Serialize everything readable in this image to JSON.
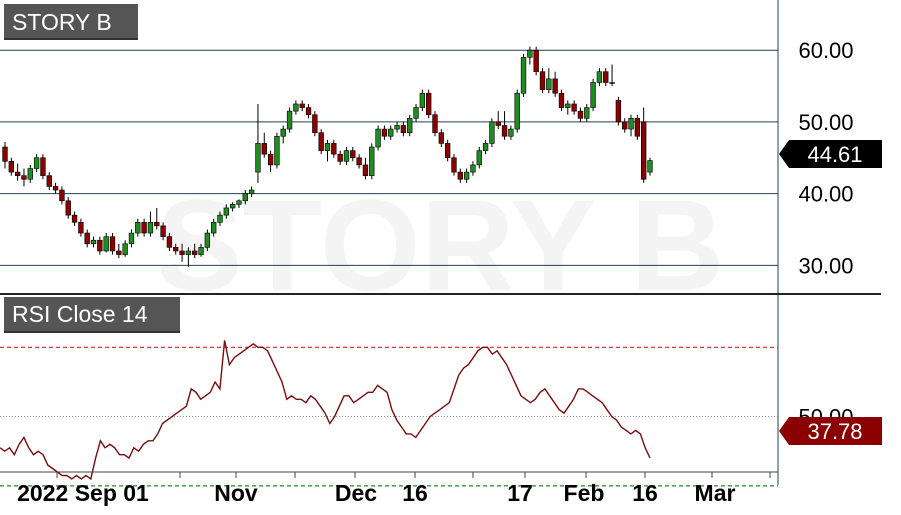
{
  "chart_data": [
    {
      "type": "candlestick",
      "title": "STORY B",
      "watermark": "STORY B",
      "ylim": [
        26,
        67
      ],
      "y_ticks": [
        "30.00",
        "40.00",
        "50.00",
        "60.00"
      ],
      "last_price": "44.61",
      "colors": {
        "up": "#1e8c1e",
        "down": "#8b0000",
        "last_badge": "#000000"
      },
      "candles": [
        [
          46.5,
          47.2,
          43.5,
          44.5
        ],
        [
          44.5,
          45.0,
          42.5,
          43.0
        ],
        [
          43.0,
          44.2,
          41.8,
          42.5
        ],
        [
          42.5,
          43.5,
          41.0,
          42.0
        ],
        [
          42.0,
          44.0,
          41.5,
          43.5
        ],
        [
          43.5,
          45.5,
          43.0,
          45.0
        ],
        [
          45.0,
          45.5,
          42.0,
          42.5
        ],
        [
          42.5,
          43.0,
          40.5,
          41.0
        ],
        [
          41.0,
          41.5,
          40.0,
          40.5
        ],
        [
          40.5,
          41.0,
          38.5,
          39.0
        ],
        [
          39.0,
          39.5,
          36.5,
          37.0
        ],
        [
          37.0,
          37.5,
          35.5,
          36.0
        ],
        [
          36.0,
          36.5,
          34.0,
          34.5
        ],
        [
          34.5,
          35.0,
          32.5,
          33.0
        ],
        [
          33.0,
          34.0,
          32.5,
          33.5
        ],
        [
          33.5,
          34.0,
          31.5,
          32.0
        ],
        [
          32.0,
          34.5,
          31.8,
          34.0
        ],
        [
          34.0,
          34.5,
          31.5,
          32.0
        ],
        [
          32.0,
          33.0,
          31.0,
          31.5
        ],
        [
          31.5,
          33.5,
          31.2,
          33.0
        ],
        [
          33.0,
          35.0,
          32.5,
          34.5
        ],
        [
          34.5,
          36.5,
          34.0,
          36.0
        ],
        [
          36.0,
          36.5,
          34.0,
          34.5
        ],
        [
          34.5,
          37.5,
          34.0,
          36.0
        ],
        [
          36.0,
          38.0,
          35.0,
          35.5
        ],
        [
          35.5,
          36.0,
          33.5,
          34.0
        ],
        [
          34.0,
          34.5,
          32.0,
          32.5
        ],
        [
          32.5,
          33.0,
          31.5,
          32.0
        ],
        [
          32.0,
          33.0,
          30.5,
          31.5
        ],
        [
          31.5,
          32.5,
          29.8,
          32.0
        ],
        [
          32.0,
          33.0,
          31.0,
          31.5
        ],
        [
          31.5,
          33.0,
          31.2,
          32.5
        ],
        [
          32.5,
          35.0,
          32.0,
          34.5
        ],
        [
          34.5,
          36.5,
          34.0,
          36.0
        ],
        [
          36.0,
          37.5,
          35.5,
          37.0
        ],
        [
          37.0,
          38.5,
          36.5,
          38.0
        ],
        [
          38.0,
          38.8,
          37.5,
          38.5
        ],
        [
          38.5,
          39.2,
          38.0,
          39.0
        ],
        [
          39.0,
          40.5,
          38.5,
          40.0
        ],
        [
          40.0,
          41.0,
          39.5,
          40.5
        ],
        [
          43.0,
          52.5,
          41.5,
          47.0
        ],
        [
          47.0,
          48.5,
          45.0,
          45.5
        ],
        [
          45.5,
          46.0,
          43.0,
          44.0
        ],
        [
          44.0,
          48.5,
          43.5,
          48.0
        ],
        [
          48.0,
          49.5,
          47.0,
          49.0
        ],
        [
          49.0,
          52.0,
          48.5,
          51.5
        ],
        [
          51.5,
          53.0,
          51.0,
          52.5
        ],
        [
          52.5,
          53.0,
          51.5,
          52.0
        ],
        [
          52.0,
          52.5,
          50.5,
          51.0
        ],
        [
          51.0,
          51.5,
          48.0,
          48.5
        ],
        [
          48.5,
          49.0,
          45.5,
          46.0
        ],
        [
          46.0,
          47.5,
          44.5,
          47.0
        ],
        [
          47.0,
          47.5,
          45.0,
          45.5
        ],
        [
          45.5,
          46.0,
          44.0,
          44.5
        ],
        [
          44.5,
          46.5,
          44.0,
          46.0
        ],
        [
          46.0,
          46.5,
          44.5,
          45.0
        ],
        [
          45.0,
          45.5,
          43.5,
          44.0
        ],
        [
          44.0,
          45.0,
          42.0,
          42.5
        ],
        [
          42.5,
          47.0,
          42.0,
          46.5
        ],
        [
          46.5,
          49.5,
          46.0,
          49.0
        ],
        [
          49.0,
          49.5,
          47.5,
          48.0
        ],
        [
          48.0,
          49.5,
          47.5,
          49.0
        ],
        [
          49.0,
          50.0,
          48.5,
          49.5
        ],
        [
          49.5,
          50.0,
          48.0,
          48.5
        ],
        [
          48.5,
          51.0,
          48.0,
          50.5
        ],
        [
          50.5,
          52.5,
          50.0,
          52.0
        ],
        [
          52.0,
          54.5,
          51.5,
          54.0
        ],
        [
          54.0,
          54.5,
          50.5,
          51.0
        ],
        [
          51.0,
          51.5,
          48.0,
          48.5
        ],
        [
          48.5,
          49.0,
          46.5,
          47.0
        ],
        [
          47.0,
          47.5,
          44.5,
          45.0
        ],
        [
          45.0,
          45.5,
          42.5,
          43.0
        ],
        [
          43.0,
          43.5,
          41.5,
          42.0
        ],
        [
          42.0,
          43.5,
          41.5,
          43.0
        ],
        [
          43.0,
          44.5,
          42.5,
          44.0
        ],
        [
          44.0,
          46.5,
          43.5,
          46.0
        ],
        [
          46.0,
          47.5,
          45.5,
          47.0
        ],
        [
          47.0,
          50.5,
          46.5,
          50.0
        ],
        [
          50.0,
          51.5,
          49.0,
          49.5
        ],
        [
          49.5,
          51.5,
          47.5,
          48.0
        ],
        [
          48.0,
          49.5,
          47.5,
          49.0
        ],
        [
          49.0,
          54.5,
          48.5,
          54.0
        ],
        [
          54.0,
          59.5,
          53.5,
          59.0
        ],
        [
          59.0,
          60.5,
          58.0,
          60.0
        ],
        [
          60.0,
          60.5,
          56.5,
          57.0
        ],
        [
          57.0,
          57.5,
          54.0,
          54.5
        ],
        [
          54.5,
          57.5,
          54.0,
          56.0
        ],
        [
          56.0,
          57.0,
          53.5,
          54.0
        ],
        [
          54.0,
          54.5,
          51.5,
          52.0
        ],
        [
          52.0,
          53.0,
          51.0,
          52.5
        ],
        [
          52.5,
          53.0,
          51.0,
          51.5
        ],
        [
          51.5,
          52.0,
          50.0,
          50.5
        ],
        [
          50.5,
          52.5,
          50.0,
          52.0
        ],
        [
          52.0,
          56.0,
          51.5,
          55.5
        ],
        [
          55.5,
          57.5,
          55.0,
          57.0
        ],
        [
          57.0,
          57.5,
          55.0,
          55.5
        ],
        [
          55.5,
          58.0,
          55.0,
          55.5
        ],
        [
          53.0,
          53.5,
          49.5,
          50.0
        ],
        [
          50.0,
          50.5,
          48.5,
          49.0
        ],
        [
          49.0,
          51.0,
          48.0,
          50.5
        ],
        [
          50.5,
          51.0,
          47.5,
          48.0
        ],
        [
          50.0,
          52.0,
          41.5,
          42.0
        ],
        [
          43.0,
          45.0,
          42.5,
          44.61
        ]
      ]
    },
    {
      "type": "line",
      "title": "RSI Close 14",
      "ylim": [
        34,
        75
      ],
      "y_ticks": [
        "50.00"
      ],
      "levels": {
        "overbought": 70,
        "oversold": 30,
        "mid": 50
      },
      "last_value": "37.78",
      "colors": {
        "line": "#7a0d0d",
        "overbought": "#e02020",
        "oversold": "#1e8c1e",
        "last_badge": "#8b0000"
      },
      "values": [
        41,
        40,
        41,
        39,
        42,
        44,
        41,
        39,
        40,
        39,
        36,
        35,
        34,
        33,
        33,
        32,
        33,
        32,
        33,
        32,
        38,
        43,
        41,
        42,
        41,
        39,
        39,
        38,
        41,
        40,
        42,
        43,
        43,
        45,
        48,
        49,
        50,
        51,
        52,
        53,
        58,
        57,
        55,
        56,
        57,
        60,
        58,
        72,
        65,
        67,
        68,
        69,
        70,
        71,
        70,
        70,
        69,
        66,
        63,
        60,
        55,
        56,
        55,
        55,
        54,
        56,
        55,
        53,
        51,
        48,
        50,
        53,
        56,
        56,
        54,
        55,
        56,
        57,
        57,
        59,
        58,
        57,
        52,
        49,
        47,
        45,
        45,
        44,
        46,
        48,
        50,
        51,
        52,
        53,
        54,
        58,
        62,
        64,
        65,
        67,
        69,
        70,
        70,
        68,
        69,
        67,
        65,
        62,
        59,
        56,
        55,
        54,
        55,
        57,
        58,
        56,
        54,
        52,
        51,
        53,
        55,
        58,
        58,
        57,
        56,
        55,
        54,
        52,
        50,
        49,
        47,
        46,
        45,
        46,
        45,
        41,
        38
      ]
    }
  ],
  "x_axis": {
    "labels": [
      "2022 Sep 01",
      "Nov",
      "Dec",
      "16",
      "17",
      "Feb",
      "16",
      "Mar"
    ]
  }
}
